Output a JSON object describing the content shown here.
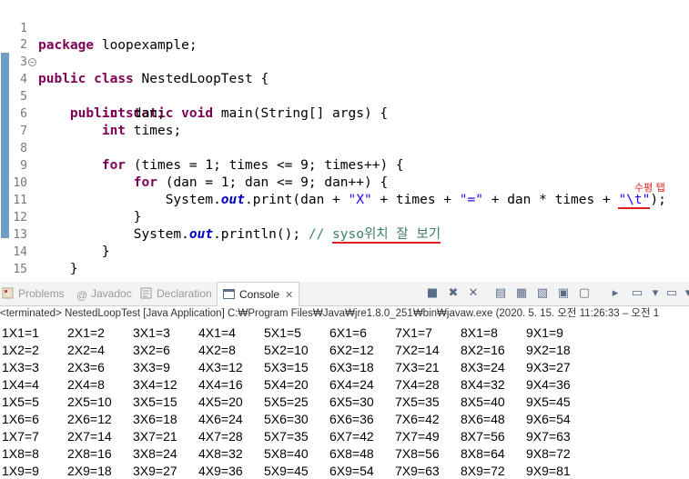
{
  "editor": {
    "line_numbers": [
      "1",
      "2",
      "3",
      "4",
      "5",
      "6",
      "7",
      "8",
      "9",
      "10",
      "11",
      "12",
      "13",
      "14",
      "15"
    ],
    "l1": {
      "kw": "package",
      "rest": " loopexample;"
    },
    "l3": {
      "kw1": "public",
      "kw2": "class",
      "rest": " NestedLoopTest {"
    },
    "l4": {
      "kw1": "public",
      "kw2": "static",
      "kw3": "void",
      "rest": " main(String[] args) {"
    },
    "l5": {
      "kw": "int",
      "var": "dan",
      "end": ";"
    },
    "l6": {
      "kw": "int",
      "var": "times",
      "end": ";"
    },
    "l8": {
      "kw": "for",
      "p1": " (",
      "v1": "times",
      "p2": " = 1; ",
      "v2": "times",
      "p3": " <= 9; ",
      "v3": "times",
      "p4": "++) {"
    },
    "l9": {
      "kw": "for",
      "p1": " (",
      "v1": "dan",
      "p2": " = 1; ",
      "v2": "dan",
      "p3": " <= 9; ",
      "v3": "dan",
      "p4": "++) {"
    },
    "l10": {
      "a": "System.",
      "out": "out",
      "b": ".print(",
      "v1": "dan",
      "c": " + ",
      "s1": "\"X\"",
      "d": " + ",
      "v2": "times",
      "e": " + ",
      "s2": "\"=\"",
      "f": " + ",
      "v3": "dan",
      "g": " * ",
      "v4": "times",
      "h": " + ",
      "s3": "\"\\t\"",
      "i": ");"
    },
    "l11": "}",
    "l12": {
      "a": "System.",
      "out": "out",
      "b": ".println(); ",
      "cmt1": "// ",
      "cmt2": "syso위치 잘 보기"
    },
    "l13": "}",
    "l14": "}",
    "l15": "}",
    "annotation": "수평 탭"
  },
  "tabs": [
    {
      "label": "Problems"
    },
    {
      "label": "Javadoc"
    },
    {
      "label": "Declaration"
    },
    {
      "label": "Console"
    }
  ],
  "console": {
    "status": "<terminated> NestedLoopTest [Java Application] C:₩Program Files₩Java₩jre1.8.0_251₩bin₩javaw.exe  (2020. 5. 15. 오전 11:26:33 – 오전 1",
    "rows": [
      [
        "1X1=1",
        "2X1=2",
        "3X1=3",
        "4X1=4",
        "5X1=5",
        "6X1=6",
        "7X1=7",
        "8X1=8",
        "9X1=9"
      ],
      [
        "1X2=2",
        "2X2=4",
        "3X2=6",
        "4X2=8",
        "5X2=10",
        "6X2=12",
        "7X2=14",
        "8X2=16",
        "9X2=18"
      ],
      [
        "1X3=3",
        "2X3=6",
        "3X3=9",
        "4X3=12",
        "5X3=15",
        "6X3=18",
        "7X3=21",
        "8X3=24",
        "9X3=27"
      ],
      [
        "1X4=4",
        "2X4=8",
        "3X4=12",
        "4X4=16",
        "5X4=20",
        "6X4=24",
        "7X4=28",
        "8X4=32",
        "9X4=36"
      ],
      [
        "1X5=5",
        "2X5=10",
        "3X5=15",
        "4X5=20",
        "5X5=25",
        "6X5=30",
        "7X5=35",
        "8X5=40",
        "9X5=45"
      ],
      [
        "1X6=6",
        "2X6=12",
        "3X6=18",
        "4X6=24",
        "5X6=30",
        "6X6=36",
        "7X6=42",
        "8X6=48",
        "9X6=54"
      ],
      [
        "1X7=7",
        "2X7=14",
        "3X7=21",
        "4X7=28",
        "5X7=35",
        "6X7=42",
        "7X7=49",
        "8X7=56",
        "9X7=63"
      ],
      [
        "1X8=8",
        "2X8=16",
        "3X8=24",
        "4X8=32",
        "5X8=40",
        "6X8=48",
        "7X8=56",
        "8X8=64",
        "9X8=72"
      ],
      [
        "1X9=9",
        "2X9=18",
        "3X9=27",
        "4X9=36",
        "5X9=45",
        "6X9=54",
        "7X9=63",
        "8X9=72",
        "9X9=81"
      ]
    ]
  },
  "toolbar_icons": [
    "terminate-icon",
    "remove-launch-icon",
    "remove-all-icon",
    "scroll-lock-icon",
    "show-output-icon",
    "pin-console-icon",
    "display-console-icon",
    "open-console-icon",
    "new-console-icon",
    "minimize-icon",
    "maximize-icon"
  ]
}
